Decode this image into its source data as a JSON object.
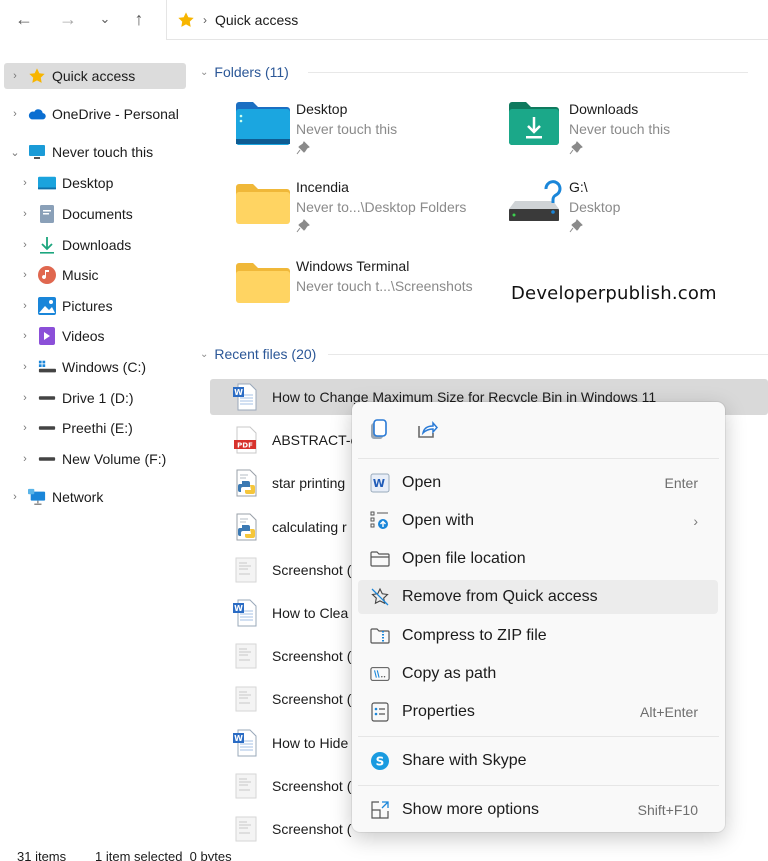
{
  "nav": {
    "back_icon": "←",
    "forward_icon": "→",
    "recent_icon": "⌄",
    "up_icon": "↑",
    "address_separator": "›",
    "breadcrumb": "Quick access"
  },
  "sidebar": {
    "items": [
      {
        "label": "Quick access",
        "chevron": "›",
        "icon": "star-icon",
        "selected": true
      },
      {
        "label": "OneDrive - Personal",
        "chevron": "›",
        "icon": "onedrive-cloud-icon"
      },
      {
        "label": "Never touch this",
        "chevron": "⌄",
        "icon": "pc-monitor-icon"
      },
      {
        "label": "Desktop",
        "chevron": "›",
        "icon": "desktop-folder-icon"
      },
      {
        "label": "Documents",
        "chevron": "›",
        "icon": "documents-icon"
      },
      {
        "label": "Downloads",
        "chevron": "›",
        "icon": "download-arrow-icon"
      },
      {
        "label": "Music",
        "chevron": "›",
        "icon": "music-icon"
      },
      {
        "label": "Pictures",
        "chevron": "›",
        "icon": "pictures-icon"
      },
      {
        "label": "Videos",
        "chevron": "›",
        "icon": "videos-icon"
      },
      {
        "label": "Windows (C:)",
        "chevron": "›",
        "icon": "windows-drive-icon"
      },
      {
        "label": "Drive 1 (D:)",
        "chevron": "›",
        "icon": "drive-icon"
      },
      {
        "label": "Preethi (E:)",
        "chevron": "›",
        "icon": "drive-icon"
      },
      {
        "label": "New Volume (F:)",
        "chevron": "›",
        "icon": "drive-icon"
      },
      {
        "label": "Network",
        "chevron": "›",
        "icon": "network-icon"
      }
    ]
  },
  "folders_section": {
    "chevron": "⌄",
    "title": "Folders (11)",
    "tiles": [
      {
        "name": "Desktop",
        "sub": "Never touch this",
        "icon": "desktop-folder-icon",
        "pinned": true
      },
      {
        "name": "Downloads",
        "sub": "Never touch this",
        "icon": "downloads-folder-icon",
        "pinned": true
      },
      {
        "name": "Incendia",
        "sub": "Never to...\\Desktop Folders",
        "icon": "folder-icon",
        "pinned": true
      },
      {
        "name": "G:\\",
        "sub": "Desktop",
        "icon": "unknown-drive-icon",
        "pinned": true
      },
      {
        "name": "Windows Terminal",
        "sub": "Never touch t...\\Screenshots",
        "icon": "folder-icon",
        "pinned": false
      }
    ]
  },
  "watermark": "Developerpublish.com",
  "recent_section": {
    "chevron": "⌄",
    "title": "Recent files (20)",
    "files": [
      {
        "name": "How to Change Maximum Size for Recycle Bin in Windows 11",
        "icon": "word-doc-icon",
        "selected": true
      },
      {
        "name": "ABSTRACT-c",
        "icon": "pdf-icon"
      },
      {
        "name": "star printing",
        "icon": "python-file-icon"
      },
      {
        "name": "calculating r",
        "icon": "python-file-icon"
      },
      {
        "name": "Screenshot (",
        "icon": "screenshot-thumb-icon"
      },
      {
        "name": "How to Clea",
        "icon": "word-doc-icon"
      },
      {
        "name": "Screenshot (",
        "icon": "screenshot-thumb-icon"
      },
      {
        "name": "Screenshot (",
        "icon": "screenshot-thumb-icon"
      },
      {
        "name": "How to Hide",
        "icon": "word-doc-icon"
      },
      {
        "name": "Screenshot (",
        "icon": "screenshot-thumb-icon"
      },
      {
        "name": "Screenshot (",
        "icon": "screenshot-thumb-icon"
      }
    ]
  },
  "status": {
    "items": "31 items",
    "selection": "1 item selected  0 bytes"
  },
  "context_menu": {
    "quick_actions": [
      {
        "name": "copy",
        "icon": "copy-icon"
      },
      {
        "name": "share",
        "icon": "share-icon"
      }
    ],
    "items": [
      {
        "label": "Open",
        "shortcut": "Enter",
        "icon": "word-app-icon"
      },
      {
        "label": "Open with",
        "submenu": "›",
        "icon": "open-with-icon"
      },
      {
        "label": "Open file location",
        "icon": "folder-outline-icon"
      },
      {
        "label": "Remove from Quick access",
        "icon": "unpin-star-icon",
        "hover": true
      },
      {
        "label": "Compress to ZIP file",
        "icon": "zip-folder-icon"
      },
      {
        "label": "Copy as path",
        "icon": "copy-path-icon"
      },
      {
        "label": "Properties",
        "shortcut": "Alt+Enter",
        "icon": "properties-icon"
      },
      {
        "label": "Share with Skype",
        "icon": "skype-icon"
      },
      {
        "label": "Show more options",
        "shortcut": "Shift+F10",
        "icon": "show-more-icon"
      }
    ]
  },
  "colors": {
    "accent": "#0067c0",
    "section_header": "#2b5797",
    "selected_bg": "#d9d9d9",
    "star": "#f7b500"
  }
}
